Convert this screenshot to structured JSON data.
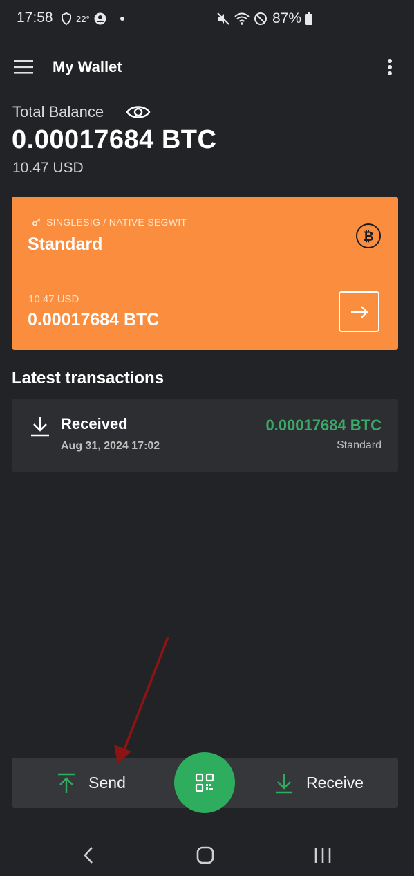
{
  "status_bar": {
    "time": "17:58",
    "temperature": "22°",
    "battery": "87%",
    "icons_left": [
      "shield-icon",
      "account-icon"
    ],
    "icons_right": [
      "mute-icon",
      "wifi-icon",
      "do-not-disturb-icon",
      "battery-icon"
    ]
  },
  "app_bar": {
    "title": "My Wallet",
    "menu_icon": "hamburger-icon",
    "more_icon": "more-vertical-icon"
  },
  "balance": {
    "label": "Total Balance",
    "btc": "0.00017684 BTC",
    "usd": "10.47 USD"
  },
  "wallet_card": {
    "type": "SINGLESIG / NATIVE SEGWIT",
    "name": "Standard",
    "usd": "10.47 USD",
    "btc": "0.00017684 BTC",
    "color": "#fb8d3e"
  },
  "transactions": {
    "heading": "Latest transactions",
    "items": [
      {
        "title": "Received",
        "date": "Aug 31, 2024 17:02",
        "amount": "0.00017684 BTC",
        "wallet": "Standard",
        "amount_color": "#3aa866"
      }
    ]
  },
  "actions": {
    "send_label": "Send",
    "receive_label": "Receive",
    "scan_icon": "qr-scan-icon",
    "accent": "#2fad5f"
  }
}
